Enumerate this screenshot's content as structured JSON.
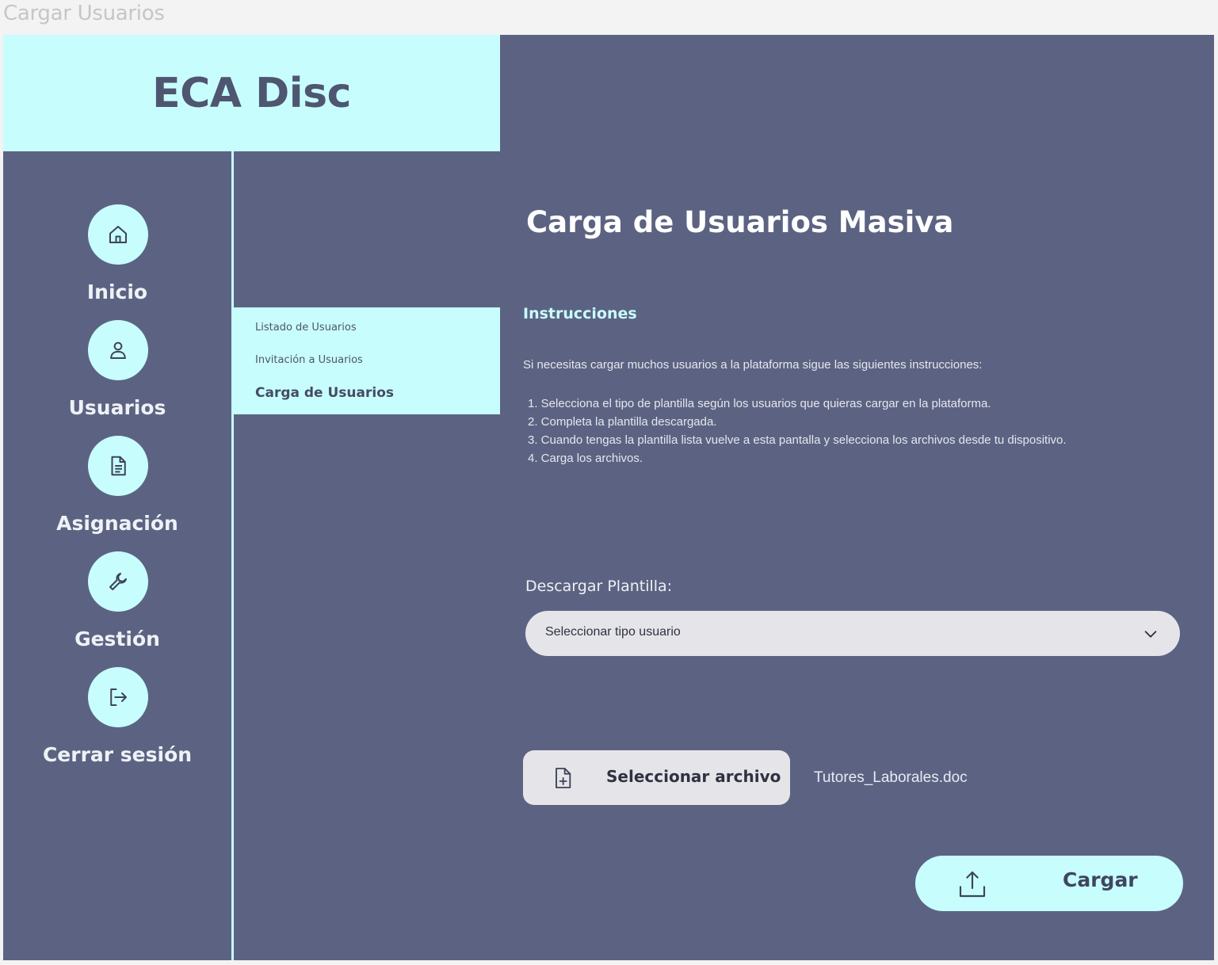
{
  "window": {
    "title": "Cargar Usuarios"
  },
  "brand": {
    "name": "ECA Disc"
  },
  "colors": {
    "accent": "#c8fdfe",
    "background": "#5c6382",
    "control": "#e5e5e9"
  },
  "nav": {
    "items": [
      {
        "label": "Inicio",
        "icon": "home-icon"
      },
      {
        "label": "Usuarios",
        "icon": "user-icon"
      },
      {
        "label": "Asignación",
        "icon": "document-icon"
      },
      {
        "label": "Gestión",
        "icon": "wrench-icon"
      },
      {
        "label": "Cerrar sesión",
        "icon": "logout-icon"
      }
    ]
  },
  "submenu": {
    "items": [
      {
        "label": "Listado de Usuarios",
        "active": false
      },
      {
        "label": "Invitación a Usuarios",
        "active": false
      },
      {
        "label": "Carga de Usuarios",
        "active": true
      }
    ]
  },
  "main": {
    "title": "Carga de Usuarios Masiva",
    "instructions": {
      "heading": "Instrucciones",
      "intro": "Si necesitas cargar muchos usuarios a la plataforma sigue las siguientes instrucciones:",
      "steps": [
        "1. Selecciona el tipo de plantilla según los usuarios que quieras cargar en la plataforma.",
        "2. Completa la plantilla descargada.",
        "3. Cuando tengas la plantilla lista vuelve a esta pantalla y selecciona los archivos desde tu dispositivo.",
        "4. Carga los archivos."
      ]
    },
    "download": {
      "label": "Descargar Plantilla:",
      "select_value": "Seleccionar tipo usuario"
    },
    "file": {
      "button_label": "Seleccionar archivo",
      "selected_name": "Tutores_Laborales.doc"
    },
    "upload": {
      "label": "Cargar"
    }
  }
}
